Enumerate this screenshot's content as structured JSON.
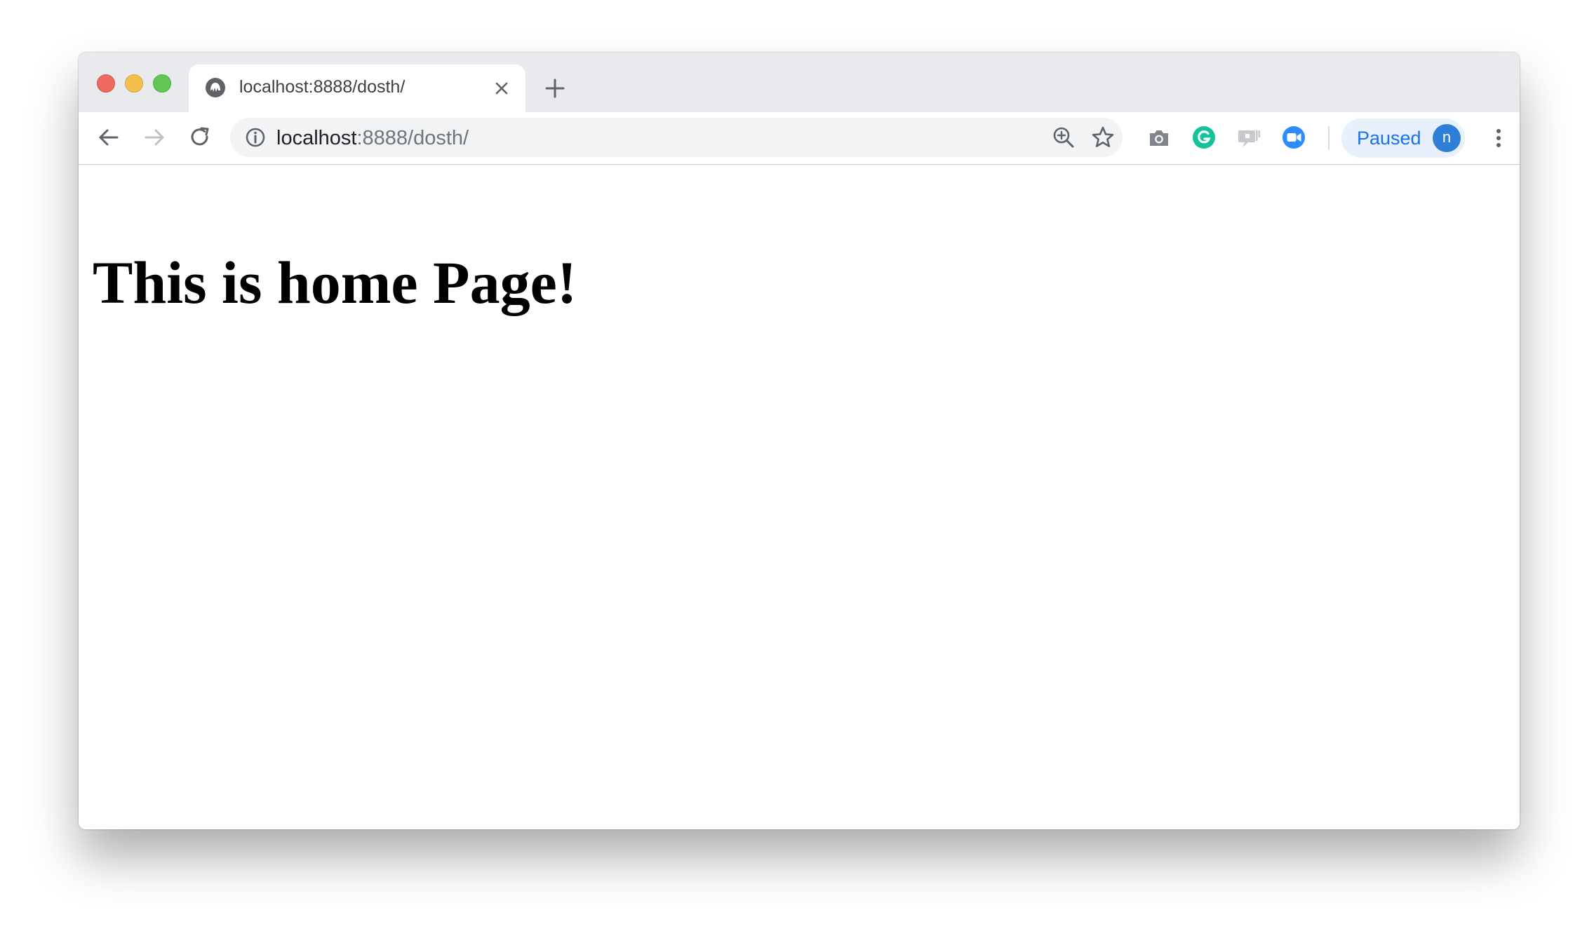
{
  "browser": {
    "tab": {
      "title": "localhost:8888/dosth/",
      "favicon": "globe-icon"
    },
    "address": {
      "host": "localhost",
      "path": ":8888/dosth/"
    },
    "profile": {
      "status": "Paused",
      "avatar_initial": "n"
    },
    "icons": {
      "back": "back-arrow-icon",
      "forward": "forward-arrow-icon",
      "reload": "reload-icon",
      "site_info": "info-icon",
      "zoom": "zoom-in-icon",
      "bookmark": "star-icon",
      "screenshot": "camera-icon",
      "grammarly": "grammarly-icon",
      "cast": "cast-icon",
      "zoom_meeting": "video-camera-icon",
      "menu": "more-vert-icon"
    },
    "colors": {
      "tabstrip": "#e8eaed",
      "accent": "#1a73e8",
      "traffic_red": "#ed6a5e",
      "traffic_yellow": "#f5bf4f",
      "traffic_green": "#62c554"
    }
  },
  "page": {
    "heading": "This is home Page!"
  }
}
